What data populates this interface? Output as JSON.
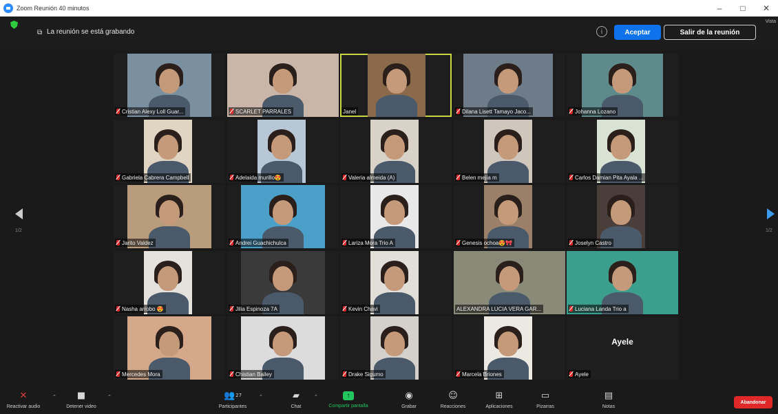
{
  "window": {
    "title": "Zoom Reunión 40 minutos",
    "controls": [
      "–",
      "□",
      "✕"
    ]
  },
  "recording_bar": {
    "message": "La reunión se está grabando",
    "info_label": "i",
    "accept_label": "Aceptar",
    "leave_label": "Salir de la reunión",
    "view_label": "Vista"
  },
  "pagination": {
    "left": "1/2",
    "right": "1/2"
  },
  "participants": [
    {
      "name": "Cristian Alexy Loll Guar...",
      "muted": true,
      "color": "#7a8fa0"
    },
    {
      "name": "SCARLET PARRALES",
      "muted": true,
      "color": "#c9b6a8"
    },
    {
      "name": "Janel",
      "muted": false,
      "color": "#8a6a4a",
      "active": true
    },
    {
      "name": "Dilana Lisett Tamayo Jaco...",
      "muted": true,
      "color": "#6e7b88"
    },
    {
      "name": "Johanna Lozano",
      "muted": true,
      "color": "#5f8a8c"
    },
    {
      "name": "Gabriela Cabrera Campbell",
      "muted": true,
      "color": "#e0d4c2"
    },
    {
      "name": "Adelaida murillo😍",
      "muted": true,
      "color": "#b8c7d6"
    },
    {
      "name": "Valeria almeida (A)",
      "muted": true,
      "color": "#d8d2c8"
    },
    {
      "name": "Belen mejia m",
      "muted": true,
      "color": "#cfc6bc"
    },
    {
      "name": "Carlos Damian Pita Ayala ...",
      "muted": true,
      "color": "#d9e3d3"
    },
    {
      "name": "Jarito Valdez",
      "muted": true,
      "color": "#b89c7c"
    },
    {
      "name": "Andrei Guachichulca",
      "muted": true,
      "color": "#4aa0c8"
    },
    {
      "name": "Lariza Mora Trio A",
      "muted": true,
      "color": "#e8e8e8"
    },
    {
      "name": "Genesis ochoa😍🎀",
      "muted": true,
      "color": "#9a8068"
    },
    {
      "name": "Joselyn Castro",
      "muted": true,
      "color": "#4a3e3a"
    },
    {
      "name": "Nasha arrobo 😍",
      "muted": true,
      "color": "#e5e1dc"
    },
    {
      "name": "Jilia Espinoza 7A",
      "muted": true,
      "color": "#3a3a3a"
    },
    {
      "name": "Kevin Chavi",
      "muted": true,
      "color": "#e2ded8"
    },
    {
      "name": "ALEXANDRA LUCIA VERA GAR...",
      "muted": false,
      "color": "#8a8a78"
    },
    {
      "name": "Luciana Landa Trio a",
      "muted": true,
      "color": "#3c9e8c"
    },
    {
      "name": "Mercedes Mora",
      "muted": true,
      "color": "#d6a88a"
    },
    {
      "name": "Chistian Bailey",
      "muted": true,
      "color": "#dcdcdc"
    },
    {
      "name": "Drake Sigumo",
      "muted": true,
      "color": "#d4d0cc"
    },
    {
      "name": "Marcela Briones",
      "muted": true,
      "color": "#ece8e2"
    },
    {
      "name": "Ayele",
      "muted": true,
      "color": "#1e1e1e",
      "no_video": true,
      "display_name": "Ayele"
    }
  ],
  "toolbar": {
    "audio": "Reactivar audio",
    "video": "Detener video",
    "participants": "Participantes",
    "participants_count": "27",
    "chat": "Chat",
    "share": "Compartir pantalla",
    "record": "Grabar",
    "reactions": "Reacciones",
    "apps": "Aplicaciones",
    "whiteboards": "Pizarras",
    "notes": "Notas",
    "end": "Abandonar"
  }
}
